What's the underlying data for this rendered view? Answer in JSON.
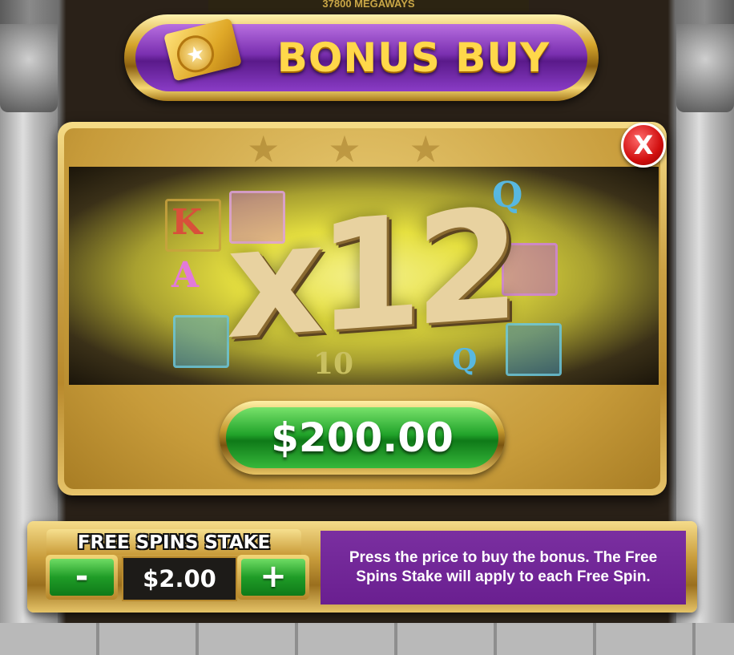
{
  "game": {
    "top_banner_text": "37800 MEGAWAYS"
  },
  "title": {
    "text": "BONUS BUY",
    "icon": "ticket-icon"
  },
  "close_button": {
    "label": "X",
    "icon": "close-icon"
  },
  "preview": {
    "multiplier": "x12",
    "symbols": [
      "K",
      "A",
      "Q",
      "Q",
      "10"
    ]
  },
  "price_button": {
    "label": "$200.00"
  },
  "stake": {
    "label": "FREE SPINS STAKE",
    "value": "$2.00",
    "decrease_label": "-",
    "increase_label": "+"
  },
  "info": {
    "text": "Press the price to buy the bonus. The Free Spins Stake will apply to each Free Spin."
  },
  "colors": {
    "title_purple": "#7a2fb0",
    "title_gold_text": "#ffd84a",
    "price_green": "#21a32a",
    "info_purple": "#6a1f90",
    "close_red": "#d10f0f"
  }
}
